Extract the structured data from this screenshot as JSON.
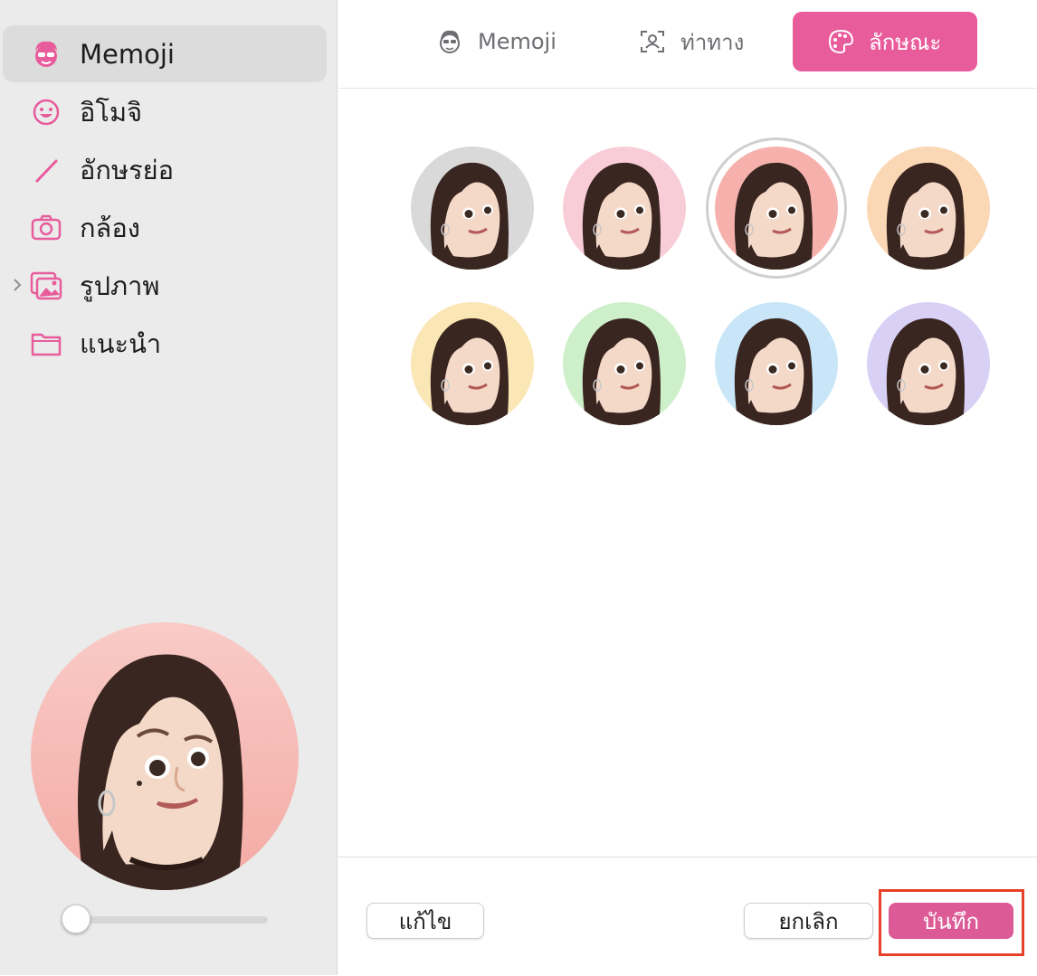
{
  "sidebar": {
    "items": [
      {
        "label": "Memoji",
        "icon": "memoji-face-icon"
      },
      {
        "label": "อิโมจิ",
        "icon": "smiley-icon"
      },
      {
        "label": "อักษรย่อ",
        "icon": "pencil-icon"
      },
      {
        "label": "กล้อง",
        "icon": "camera-icon"
      },
      {
        "label": "รูปภาพ",
        "icon": "photos-icon"
      },
      {
        "label": "แนะนำ",
        "icon": "folder-icon"
      }
    ],
    "active_index": 0,
    "zoom_slider_value": 0
  },
  "tabs": [
    {
      "label": "Memoji",
      "icon": "memoji-face-icon"
    },
    {
      "label": "ท่าทาง",
      "icon": "pose-icon"
    },
    {
      "label": "ลักษณะ",
      "icon": "palette-icon"
    }
  ],
  "active_tab": 2,
  "styles": {
    "colors": [
      "#d9d9d9",
      "#f8cdd8",
      "#f6b1ad",
      "#fbd8b5",
      "#fbe6b5",
      "#cdefc9",
      "#c8e6f8",
      "#d8d0f5"
    ],
    "selected_index": 2
  },
  "buttons": {
    "edit": "แก้ไข",
    "cancel": "ยกเลิก",
    "save": "บันทึก"
  },
  "colors": {
    "accent": "#e85c9c",
    "highlight_border": "#e8412a"
  }
}
